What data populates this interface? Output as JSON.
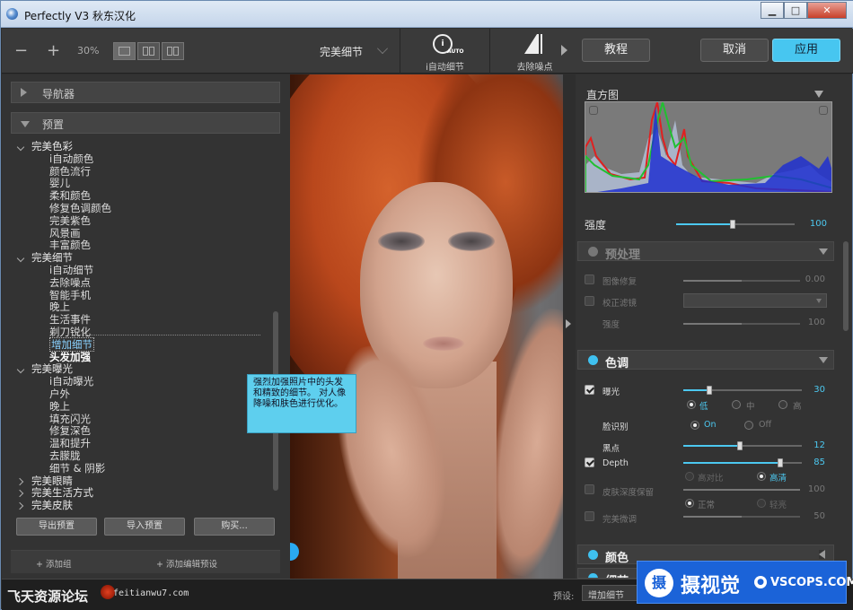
{
  "window": {
    "title": "Perfectly V3 秋东汉化",
    "minimize": "▁",
    "maximize": "□",
    "close": "✕"
  },
  "toolbar": {
    "zoom_minus": "−",
    "zoom_plus": "+",
    "zoom": "30%",
    "preset_name": "完美细节",
    "auto_label": "i自动细节",
    "auto_icon_text": "i",
    "auto_icon_sub": "AUTO",
    "noise_label": "去除噪点",
    "tutorial": "教程",
    "cancel": "取消",
    "apply": "应用"
  },
  "left": {
    "navigator": "导航器",
    "presets": "预置",
    "tree": [
      {
        "type": "g",
        "label": "完美色彩"
      },
      {
        "type": "it",
        "label": "i自动颜色"
      },
      {
        "type": "it",
        "label": "颜色流行"
      },
      {
        "type": "it",
        "label": "婴儿"
      },
      {
        "type": "it",
        "label": "柔和颜色"
      },
      {
        "type": "it",
        "label": "修复色调颜色"
      },
      {
        "type": "it",
        "label": "完美紫色"
      },
      {
        "type": "it",
        "label": "风景画"
      },
      {
        "type": "it",
        "label": "丰富颜色"
      },
      {
        "type": "g",
        "label": "完美细节"
      },
      {
        "type": "it",
        "label": "i自动细节"
      },
      {
        "type": "it",
        "label": "去除噪点"
      },
      {
        "type": "it",
        "label": "智能手机"
      },
      {
        "type": "it",
        "label": "晚上"
      },
      {
        "type": "it",
        "label": "生活事件"
      },
      {
        "type": "it",
        "label": "剃刀锐化"
      },
      {
        "type": "it sel",
        "label": "增加细节"
      },
      {
        "type": "it bright",
        "label": "头发加强"
      },
      {
        "type": "g",
        "label": "完美曝光"
      },
      {
        "type": "it",
        "label": "i自动曝光"
      },
      {
        "type": "it",
        "label": "户外"
      },
      {
        "type": "it",
        "label": "晚上"
      },
      {
        "type": "it",
        "label": "填充闪光"
      },
      {
        "type": "it",
        "label": "修复深色"
      },
      {
        "type": "it",
        "label": "温和提升"
      },
      {
        "type": "it",
        "label": "去朦胧"
      },
      {
        "type": "it",
        "label": "细节 & 阴影"
      },
      {
        "type": "g closed",
        "label": "完美眼睛"
      },
      {
        "type": "g closed",
        "label": "完美生活方式"
      },
      {
        "type": "g closed",
        "label": "完美皮肤"
      }
    ],
    "btn_export": "导出预置",
    "btn_import": "导入预置",
    "btn_buy": "购买...",
    "add_group": "+ 添加组",
    "add_preset": "+ 添加编辑预设"
  },
  "tooltip": "强烈加强照片中的头发和精致的细节。 对人像降噪和肤色进行优化。",
  "right": {
    "histogram_title": "直方图",
    "strength_label": "强度",
    "strength_value": "100",
    "strength_level": 0.48,
    "pre": {
      "title": "预处理",
      "image_restore": "图像修复",
      "image_restore_value": "0.00",
      "image_restore_level": 0.5,
      "lens_correct": "校正滤镜",
      "strength": "强度",
      "strength_value": "100",
      "strength_level": 0.5
    },
    "tone": {
      "title": "色调",
      "exposure": "曝光",
      "exposure_value": "30",
      "exposure_level": 0.22,
      "low": "低",
      "mid": "中",
      "high": "高",
      "face_detect": "脸识别",
      "on": "On",
      "off": "Off",
      "black": "黑点",
      "black_value": "12",
      "black_level": 0.48,
      "depth": "Depth",
      "depth_value": "85",
      "depth_level": 0.82,
      "high_contrast": "高对比",
      "high_clear": "高清",
      "skin_depth": "皮肤深度保留",
      "skin_depth_value": "100",
      "skin_depth_level": 1.0,
      "normal": "正常",
      "slight": "轻亮",
      "perfect_tune": "完美微调",
      "perfect_tune_value": "50",
      "perfect_tune_level": 0.5
    },
    "color": {
      "title": "颜色"
    },
    "next": {
      "title": "细节"
    }
  },
  "status": {
    "watermark1": "飞天资源论坛",
    "watermark2": "feitianwu7.com",
    "preset_label": "预设:",
    "preset_value": "增加细节"
  },
  "badge": {
    "icon": "摄",
    "text": "摄视觉",
    "dot": "●",
    "domain": "VSCOPS.COM"
  },
  "colors": {
    "accent": "#47c6f0",
    "badge": "#1b63d8"
  }
}
